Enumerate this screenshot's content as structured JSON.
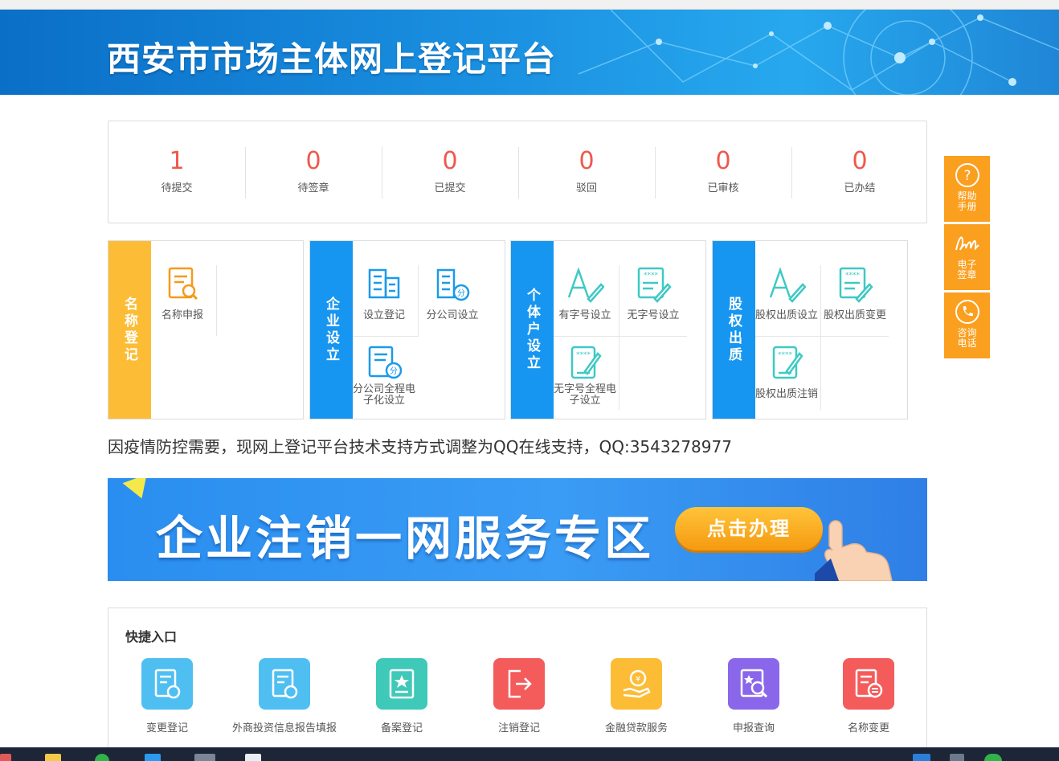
{
  "header": {
    "title": "西安市市场主体网上登记平台"
  },
  "stats": [
    {
      "value": "1",
      "label": "待提交"
    },
    {
      "value": "0",
      "label": "待签章"
    },
    {
      "value": "0",
      "label": "已提交"
    },
    {
      "value": "0",
      "label": "驳回"
    },
    {
      "value": "0",
      "label": "已审核"
    },
    {
      "value": "0",
      "label": "已办结"
    }
  ],
  "panels": [
    {
      "title": "名称登记",
      "items": [
        "名称申报"
      ]
    },
    {
      "title": "企业设立",
      "items": [
        "设立登记",
        "分公司设立",
        "分公司全程电子化设立"
      ]
    },
    {
      "title": "个体户设立",
      "items": [
        "有字号设立",
        "无字号设立",
        "无字号全程电子设立"
      ]
    },
    {
      "title": "股权出质",
      "items": [
        "股权出质设立",
        "股权出质变更",
        "股权出质注销"
      ]
    }
  ],
  "notice": "因疫情防控需要，现网上登记平台技术支持方式调整为QQ在线支持，QQ:3543278977",
  "promo": {
    "title": "企业注销一网服务专区",
    "button": "点击办理"
  },
  "quick": {
    "title": "快捷入口",
    "items": [
      {
        "label": "变更登记",
        "color": "#4fbff2",
        "icon": "change-doc-icon"
      },
      {
        "label": "外商投资信息报告填报",
        "color": "#4fbff2",
        "icon": "report-doc-icon"
      },
      {
        "label": "备案登记",
        "color": "#3ec9b8",
        "icon": "record-star-icon"
      },
      {
        "label": "注销登记",
        "color": "#f45b5b",
        "icon": "exit-icon"
      },
      {
        "label": "金融贷款服务",
        "color": "#fcbc35",
        "icon": "loan-hand-icon"
      },
      {
        "label": "申报查询",
        "color": "#8a67ea",
        "icon": "search-doc-icon"
      },
      {
        "label": "名称变更",
        "color": "#f45b5b",
        "icon": "name-change-icon"
      }
    ]
  },
  "float_menu": [
    {
      "label": "帮助手册",
      "icon": "question-icon"
    },
    {
      "label": "电子签章",
      "icon": "signature-icon"
    },
    {
      "label": "咨询电话",
      "icon": "phone-icon"
    }
  ],
  "colors": {
    "accent_blue": "#1696f0",
    "accent_orange": "#fcbc35",
    "stat_red": "#f0584c",
    "float_orange": "#fb9f1f"
  }
}
